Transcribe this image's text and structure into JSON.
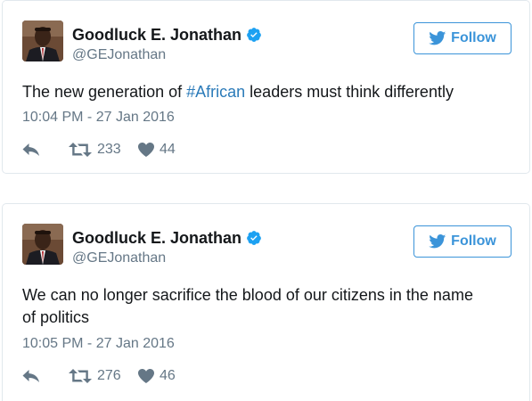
{
  "colors": {
    "accent": "#3b94d9",
    "hashtag": "#2b7bb9",
    "muted": "#657786",
    "text": "#14171a",
    "border": "#e1e8ed"
  },
  "tweets": [
    {
      "display_name": "Goodluck E. Jonathan",
      "handle": "@GEJonathan",
      "follow_label": "Follow",
      "text_before": "The new generation of ",
      "hashtag": "#African",
      "text_after": " leaders must think differently",
      "timestamp": "10:04 PM - 27 Jan 2016",
      "retweets": "233",
      "likes": "44",
      "icons": [
        "verified-icon",
        "twitter-bird-icon",
        "reply-icon",
        "retweet-icon",
        "heart-icon"
      ]
    },
    {
      "display_name": "Goodluck E. Jonathan",
      "handle": "@GEJonathan",
      "follow_label": "Follow",
      "text_line1": "We can no longer sacrifice the blood of our citizens in the name",
      "text_line2": "of politics",
      "timestamp": "10:05 PM - 27 Jan 2016",
      "retweets": "276",
      "likes": "46",
      "icons": [
        "verified-icon",
        "twitter-bird-icon",
        "reply-icon",
        "retweet-icon",
        "heart-icon"
      ]
    }
  ]
}
